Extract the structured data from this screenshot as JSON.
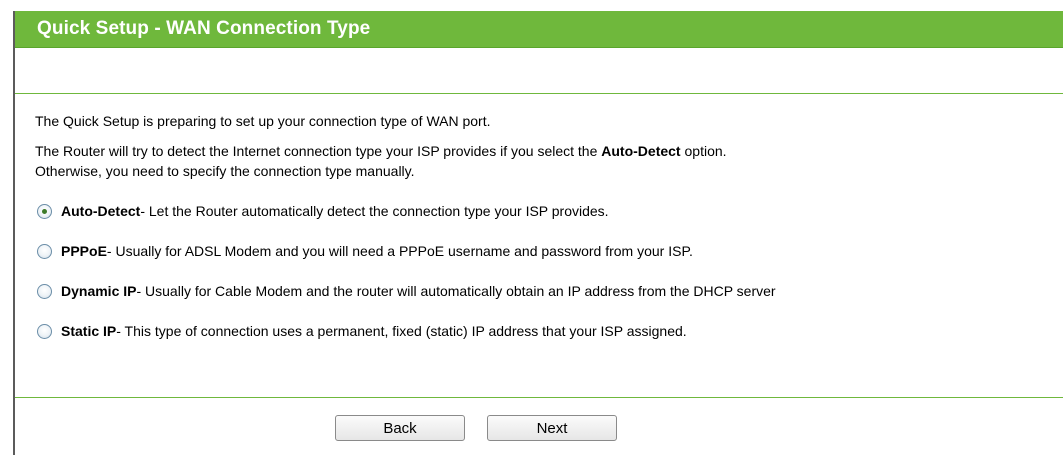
{
  "header": {
    "title": "Quick Setup - WAN Connection Type"
  },
  "intro": {
    "line1": "The Quick Setup is preparing to set up your connection type of WAN port.",
    "line2_prefix": "The Router will try to detect the Internet connection type your ISP provides if you select the ",
    "line2_bold": "Auto-Detect",
    "line2_suffix": " option.",
    "line3": "Otherwise, you need to specify the connection type manually."
  },
  "options": [
    {
      "name": "Auto-Detect",
      "description": " - Let the Router automatically detect the connection type your ISP provides.",
      "selected": true
    },
    {
      "name": "PPPoE",
      "description": " - Usually for ADSL Modem and you will need a PPPoE username and password from your ISP.",
      "selected": false
    },
    {
      "name": "Dynamic IP",
      "description": " - Usually for Cable Modem and the router will automatically obtain an IP address from the DHCP server",
      "selected": false
    },
    {
      "name": "Static IP",
      "description": " - This type of connection uses a permanent, fixed (static) IP address that your ISP assigned.",
      "selected": false
    }
  ],
  "buttons": {
    "back_label": "Back",
    "next_label": "Next"
  },
  "colors": {
    "title_bar": "#6fb83c",
    "title_text": "#ffffff",
    "rule": "#6fb83c"
  }
}
